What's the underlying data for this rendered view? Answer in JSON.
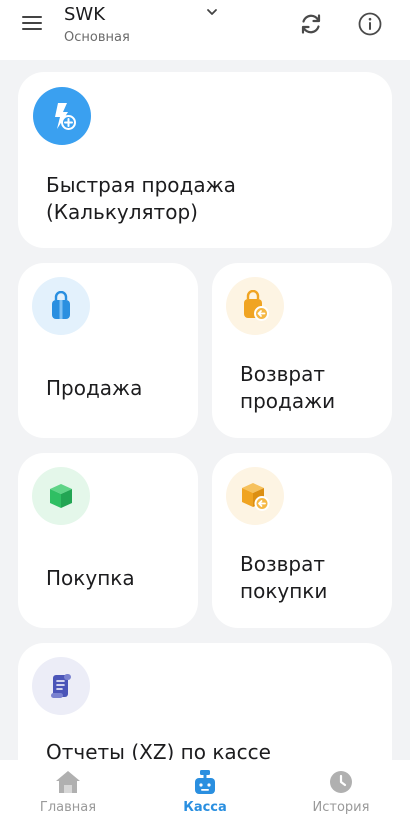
{
  "header": {
    "store_name": "SWK",
    "store_subtitle": "Основная",
    "icons": [
      "menu-icon",
      "chevron-down-icon",
      "sync-icon",
      "info-icon"
    ]
  },
  "cards": {
    "quick_sale": {
      "label": "Быстрая продажа\n(Калькулятор)",
      "icon": "lightning-plus-icon",
      "icon_color": "#3aa0f0"
    },
    "sale": {
      "label": "Продажа",
      "icon": "shopping-bag-icon",
      "icon_color": "#2a8fe0"
    },
    "sale_return": {
      "label": "Возврат\nпродажи",
      "icon": "bag-return-icon",
      "icon_color": "#f0a422"
    },
    "purchase": {
      "label": "Покупка",
      "icon": "box-icon",
      "icon_color": "#2fbf63"
    },
    "purchase_return": {
      "label": "Возврат\nпокупки",
      "icon": "box-return-icon",
      "icon_color": "#f0a422"
    },
    "reports": {
      "label": "Отчеты (XZ) по кассе",
      "icon": "receipt-scroll-icon",
      "icon_color": "#4b55b8"
    }
  },
  "bottom_nav": {
    "home": {
      "label": "Главная",
      "icon": "home-icon"
    },
    "kassa": {
      "label": "Касса",
      "icon": "cash-register-icon",
      "active": true
    },
    "history": {
      "label": "История",
      "icon": "clock-icon"
    }
  },
  "colors": {
    "accent": "#2a8fe0",
    "background": "#f2f3f5",
    "card": "#ffffff",
    "inactive_nav": "#9a9a9a"
  }
}
